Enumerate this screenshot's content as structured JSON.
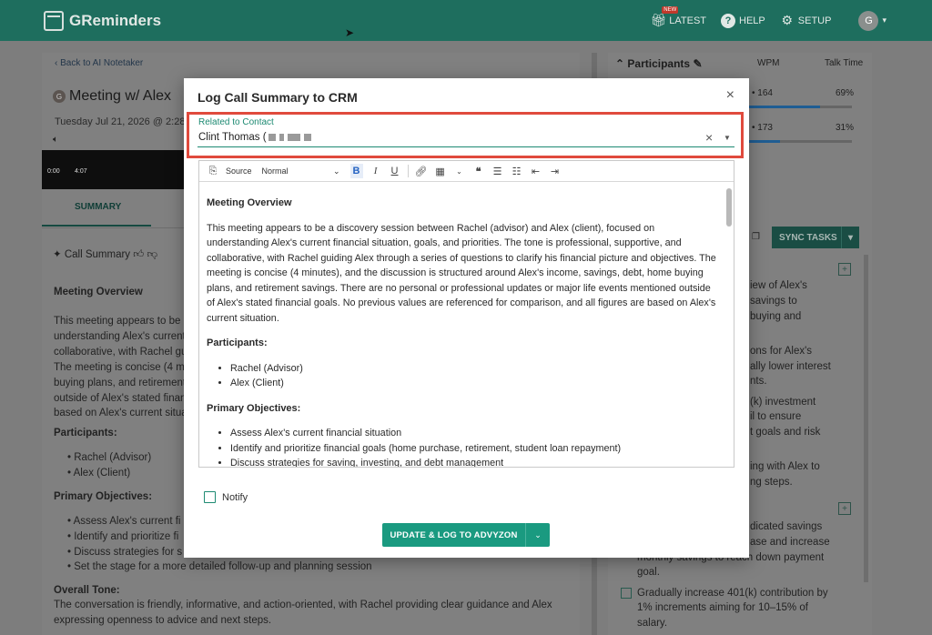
{
  "app": {
    "name": "GReminders"
  },
  "topnav": {
    "latest": "LATEST",
    "new_badge": "NEW",
    "help": "HELP",
    "setup": "SETUP",
    "avatar": "G"
  },
  "background": {
    "back_link": "‹ Back to AI Notetaker",
    "meeting_avatar": "G",
    "meeting_title": "Meeting w/ Alex",
    "meeting_date": "Tuesday Jul 21, 2026 @ 2:28",
    "player_time_start": "0:00",
    "player_time_end": "4:07",
    "tab_summary": "SUMMARY",
    "call_summary_label": "Call Summary",
    "left_lines": [
      "Meeting Overview",
      "This meeting appears to be a",
      "understanding Alex's current",
      "collaborative, with Rachel gui",
      "The meeting is concise (4 mi",
      "buying plans, and retirement",
      "outside of Alex's stated finan",
      "based on Alex's current situat",
      "Participants:",
      "• Rachel (Advisor)",
      "• Alex (Client)",
      "Primary Objectives:",
      "• Assess Alex's current fi",
      "• Identify and prioritize fi",
      "• Discuss strategies for s",
      "• Set the stage for a more detailed follow-up and planning session",
      "Overall Tone:",
      "The conversation is friendly, informative, and action-oriented, with Rachel providing clear guidance and Alex",
      "expressing openness to advice and next steps."
    ],
    "participants_header": "Participants",
    "col_wpm": "WPM",
    "col_talk": "Talk Time",
    "participant_rows": [
      {
        "wpm": "• 164",
        "talk": "69%",
        "talk_fraction": 0.69
      },
      {
        "wpm": "• 173",
        "talk": "31%",
        "talk_fraction": 0.31
      }
    ],
    "sync_tasks": "SYNC TASKS",
    "right_lines": [
      "iew of Alex's",
      "savings to",
      "buying and",
      "ons for Alex's",
      "ally lower interest",
      "nts.",
      "(k) investment",
      "il to ensure",
      "t goals and risk",
      "ing with Alex to",
      "ng steps.",
      "dicated savings",
      "ase and increase",
      "monthly savings to reach down payment",
      "goal.",
      "Gradually increase 401(k) contribution by",
      "1% increments aiming for 10–15% of",
      "salary."
    ]
  },
  "modal": {
    "title": "Log Call Summary to CRM",
    "close": "×",
    "field_label": "Related to Contact",
    "field_value": "Clint Thomas (",
    "clear": "×",
    "toolbar": {
      "source": "Source",
      "format": "Normal"
    },
    "content": {
      "overview_heading": "Meeting Overview",
      "overview_text": "This meeting appears to be a discovery session between Rachel (advisor) and Alex (client), focused on understanding Alex's current financial situation, goals, and priorities. The tone is professional, supportive, and collaborative, with Rachel guiding Alex through a series of questions to clarify his financial picture and objectives. The meeting is concise (4 minutes), and the discussion is structured around Alex's income, savings, debt, home buying plans, and retirement savings. There are no personal or professional updates or major life events mentioned outside of Alex's stated financial goals. No previous values are referenced for comparison, and all figures are based on Alex's current situation.",
      "participants_heading": "Participants:",
      "participants": [
        "Rachel (Advisor)",
        "Alex (Client)"
      ],
      "objectives_heading": "Primary Objectives:",
      "objectives": [
        "Assess Alex's current financial situation",
        "Identify and prioritize financial goals (home purchase, retirement, student loan repayment)",
        "Discuss strategies for saving, investing, and debt management"
      ]
    },
    "notify_label": "Notify",
    "primary_button": "UPDATE & LOG TO ADVYZON"
  }
}
